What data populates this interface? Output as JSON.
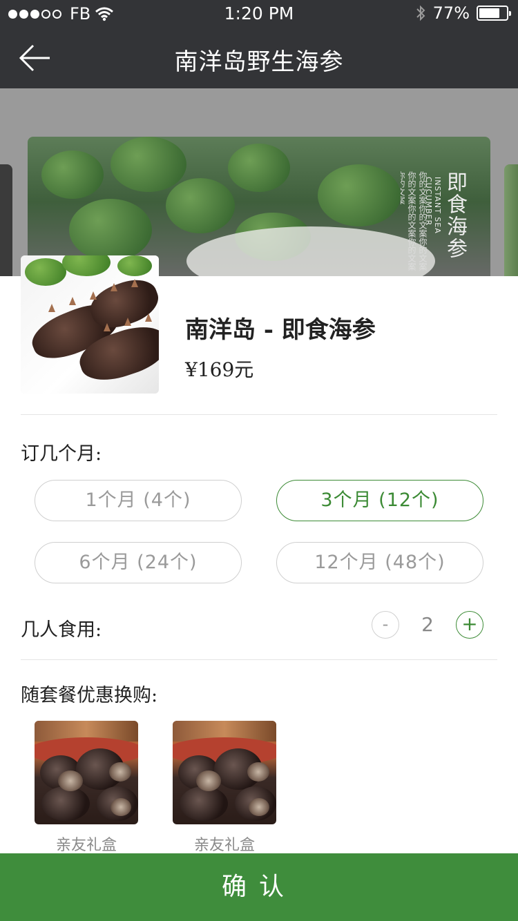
{
  "status_bar": {
    "carrier": "FB",
    "time": "1:20 PM",
    "battery": "77%",
    "battery_level": 0.77,
    "signal_filled": 3,
    "signal_total": 5
  },
  "nav": {
    "title": "南洋岛野生海参",
    "back_icon": "arrow-left-icon"
  },
  "banner": {
    "title": "即食海参",
    "subtitle_en": "INSTANT SEA CUCUMBER",
    "caption": "你的文案你的文案你的文案你的文案你的文案你的文案你的文案"
  },
  "product": {
    "name": "南洋岛 - 即食海参",
    "price": "¥169元"
  },
  "subscription": {
    "label": "订几个月:",
    "options": [
      {
        "label": "1个月 (4个)",
        "selected": false
      },
      {
        "label": "3个月 (12个)",
        "selected": true
      },
      {
        "label": "6个月 (24个)",
        "selected": false
      },
      {
        "label": "12个月 (48个)",
        "selected": false
      }
    ]
  },
  "servings": {
    "label": "几人食用:",
    "minus": "-",
    "value": "2",
    "plus": "+"
  },
  "addons": {
    "label": "随套餐优惠换购:",
    "items": [
      {
        "caption": "亲友礼盒"
      },
      {
        "caption": "亲友礼盒"
      }
    ]
  },
  "confirm_button": "确认",
  "colors": {
    "accent": "#3f8d3c",
    "accent_border": "#3b8a34",
    "topbar": "#333437"
  }
}
